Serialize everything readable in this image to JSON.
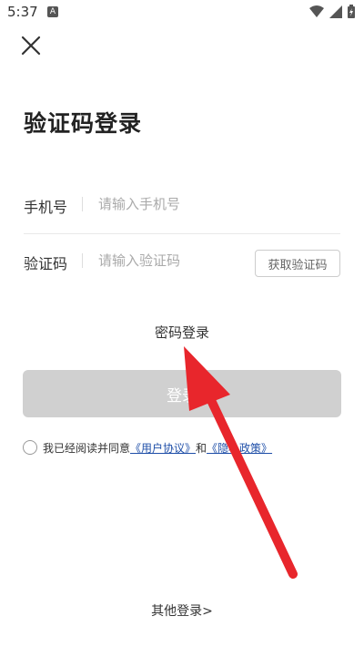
{
  "status_bar": {
    "time": "5:37",
    "notification_glyph": "A",
    "icons": [
      "wifi-icon",
      "signal-icon",
      "battery-icon"
    ]
  },
  "header": {
    "close_icon": "close-icon"
  },
  "title": "验证码登录",
  "phone": {
    "label": "手机号",
    "placeholder": "请输入手机号",
    "value": ""
  },
  "code": {
    "label": "验证码",
    "placeholder": "请输入验证码",
    "value": "",
    "get_code_label": "获取验证码"
  },
  "password_login_label": "密码登录",
  "login_button_label": "登录",
  "agreement": {
    "prefix": "我已经阅读并同意",
    "user_agreement": "《用户协议》",
    "conjunction": "和",
    "privacy_policy": "《隐私政策》",
    "checked": false
  },
  "other_login_label": "其他登录>",
  "colors": {
    "primary_text": "#333333",
    "placeholder": "#aaaaaa",
    "button_disabled": "#d0d0d0",
    "link": "#1f4fa8",
    "annotation_arrow": "#e8262c"
  }
}
